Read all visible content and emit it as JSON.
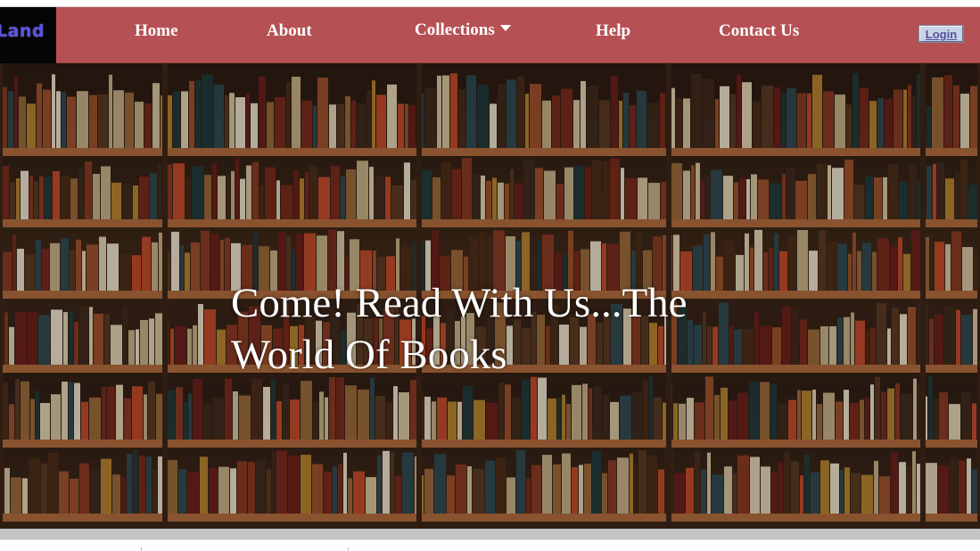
{
  "brand": {
    "logo_text": "Land"
  },
  "nav": {
    "items": [
      {
        "label": "Home"
      },
      {
        "label": "About"
      },
      {
        "label": "Collections"
      },
      {
        "label": "Help"
      },
      {
        "label": "Contact Us"
      }
    ],
    "login_label": "Login"
  },
  "hero": {
    "title": "Come! Read With Us...The World Of Books"
  },
  "colors": {
    "navbar": "#b55154",
    "logo_background": "#050505",
    "logo_text": "#5a52e0",
    "nav_text": "#ffffff",
    "login_background": "#c7d4e6"
  },
  "icons": {
    "collections_dropdown": "caret-down-icon"
  }
}
